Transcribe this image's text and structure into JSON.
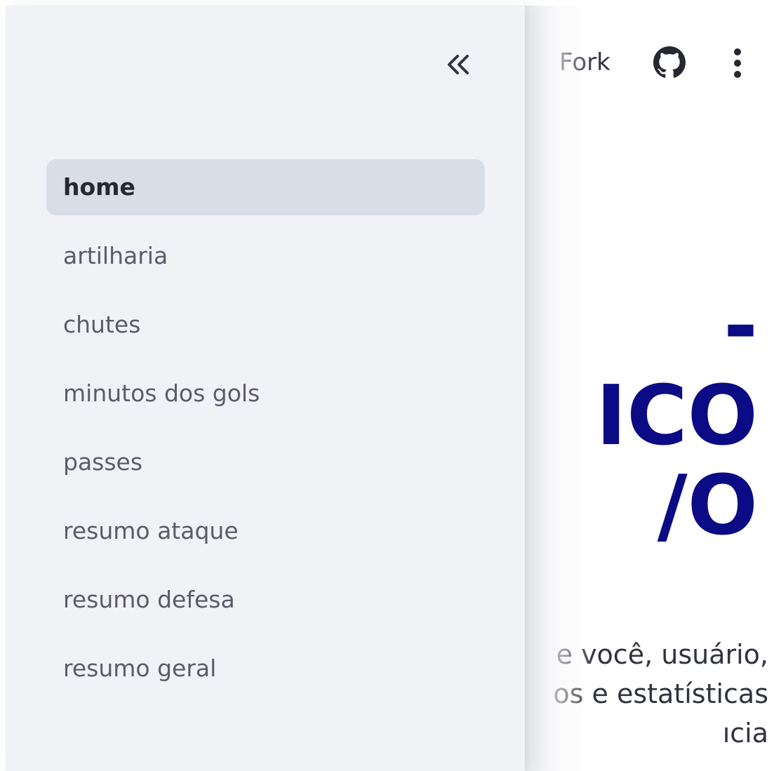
{
  "header": {
    "fork_label": "Fork"
  },
  "main": {
    "title_lines": [
      "-",
      "ICO",
      "/O"
    ],
    "intro_lines": [
      "e você, usuário,",
      "os e estatísticas",
      "ıcia"
    ]
  },
  "sidebar": {
    "collapse_glyph": "«",
    "items": [
      {
        "label": "home",
        "active": true
      },
      {
        "label": "artilharia",
        "active": false
      },
      {
        "label": "chutes",
        "active": false
      },
      {
        "label": "minutos dos gols",
        "active": false
      },
      {
        "label": "passes",
        "active": false
      },
      {
        "label": "resumo ataque",
        "active": false
      },
      {
        "label": "resumo defesa",
        "active": false
      },
      {
        "label": "resumo geral",
        "active": false
      }
    ]
  },
  "colors": {
    "title": "#0b0b86",
    "sidebar_bg": "#f0f2f6",
    "active_item_bg": "#d9dde7"
  },
  "icons": [
    "github-icon",
    "kebab-menu-icon",
    "collapse-chevrons-icon"
  ]
}
